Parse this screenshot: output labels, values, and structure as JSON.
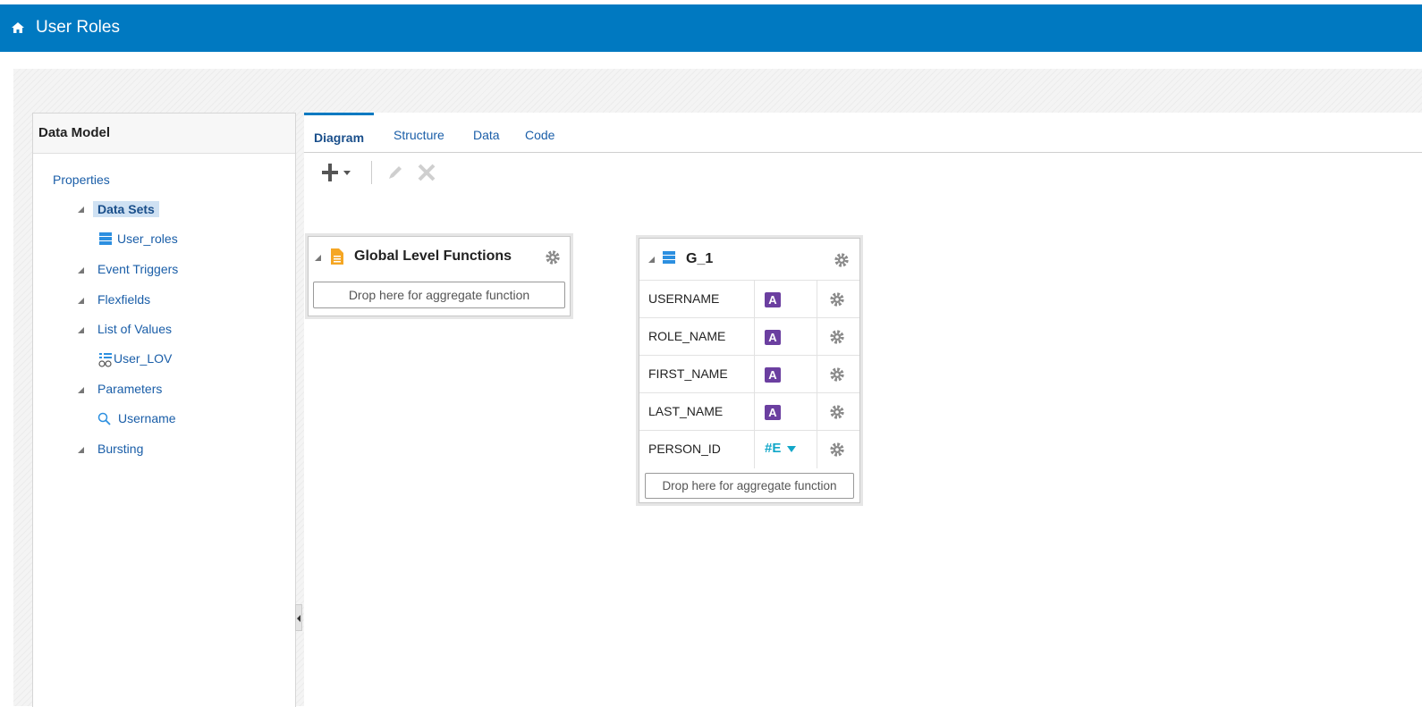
{
  "header": {
    "title": "User Roles",
    "home_icon": "home-icon"
  },
  "left_panel": {
    "title": "Data Model",
    "tree": {
      "properties": "Properties",
      "data_sets": "Data Sets",
      "data_set_item": "User_roles",
      "event_triggers": "Event Triggers",
      "flexfields": "Flexfields",
      "list_of_values": "List of Values",
      "lov_item": "User_LOV",
      "parameters": "Parameters",
      "parameter_item": "Username",
      "bursting": "Bursting"
    }
  },
  "tabs": [
    "Diagram",
    "Structure",
    "Data",
    "Code"
  ],
  "active_tab": "Diagram",
  "toolbar": {
    "icons": [
      "add-icon",
      "edit-icon",
      "delete-icon"
    ]
  },
  "global_box": {
    "title": "Global Level Functions",
    "drop_text": "Drop here for aggregate function"
  },
  "group_box": {
    "title": "G_1",
    "columns": [
      {
        "name": "USERNAME",
        "type": "A"
      },
      {
        "name": "ROLE_NAME",
        "type": "A"
      },
      {
        "name": "FIRST_NAME",
        "type": "A"
      },
      {
        "name": "LAST_NAME",
        "type": "A"
      },
      {
        "name": "PERSON_ID",
        "type": "#E"
      }
    ],
    "drop_text": "Drop here for aggregate function"
  },
  "colors": {
    "header": "#0079c1",
    "string_badge": "#6b3fa0",
    "number_badge": "#12a7c9"
  }
}
